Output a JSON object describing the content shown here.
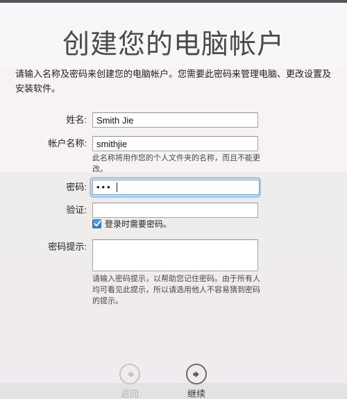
{
  "window": {
    "title": "创建您的电脑帐户"
  },
  "header": {
    "title": "创建您的电脑帐户",
    "intro": "请输入名称及密码来创建您的电脑帐户。您需要此密码来管理电脑、更改设置及安装软件。"
  },
  "form": {
    "fields": [
      {
        "name": "full-name",
        "label": "姓名:",
        "value": "Smith Jie",
        "placeholder": ""
      },
      {
        "name": "account-name",
        "label": "帐户名称:",
        "value": "smithjie",
        "placeholder": "",
        "help": "此名称将用作您的个人文件夹的名称，而且不能更改。"
      },
      {
        "name": "password",
        "label": "密码:",
        "value": "•••",
        "placeholder": "",
        "masked": true,
        "focused": true
      },
      {
        "name": "verify",
        "label": "验证:",
        "value": "",
        "placeholder": ""
      },
      {
        "name": "password-hint",
        "label": "密码提示:",
        "value": "",
        "placeholder": "",
        "help": "请输入密码提示，以帮助您记住密码。由于所有人均可看见此提示，所以请选用他人不容易猜到密码的提示。"
      }
    ],
    "checkbox": {
      "label": "登录时需要密码。",
      "checked": true
    }
  },
  "footer": {
    "back": {
      "label": "返回",
      "icon": "arrow-left-circle-icon",
      "enabled": false
    },
    "continue": {
      "label": "继续",
      "icon": "arrow-right-circle-icon",
      "enabled": true
    }
  },
  "colors": {
    "titlebar": "#54565c",
    "band_top": "#f7f6f8",
    "band_intro": "#f7f2f6",
    "band_mid": "#eeedec",
    "band_lower": "#f0ebef",
    "band_footer": "#e3e3e3",
    "focus_ring": "#a7c8e8",
    "checkbox_fill": "#2f7ac4",
    "title_text": "#4a4a4a"
  }
}
